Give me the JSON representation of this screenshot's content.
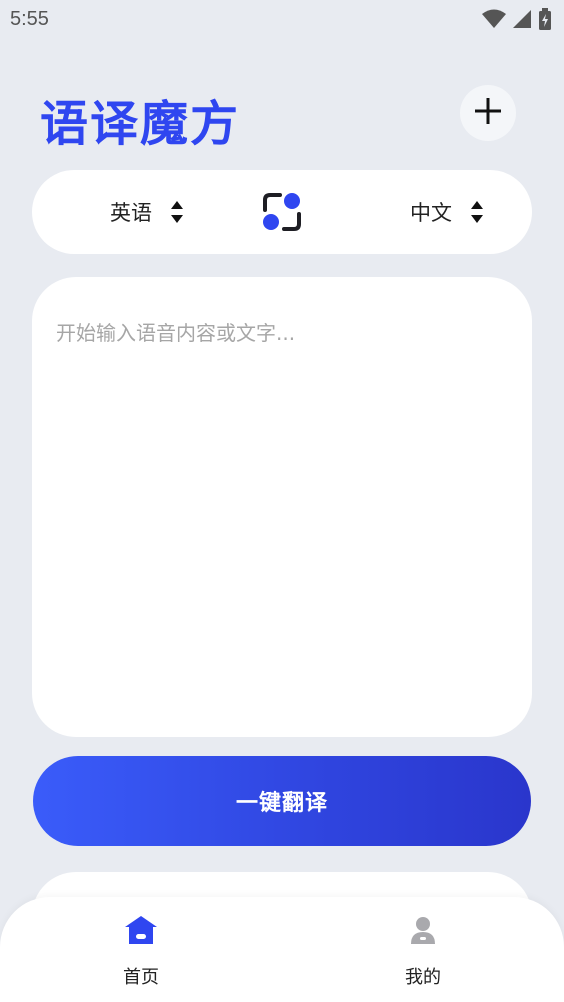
{
  "status_bar": {
    "time": "5:55",
    "icons": [
      "wifi-icon",
      "cell-signal-icon",
      "battery-charging-icon"
    ]
  },
  "header": {
    "title": "语译魔方",
    "add_icon": "plus-icon"
  },
  "language_bar": {
    "source_language": "英语",
    "target_language": "中文",
    "swap_icon": "swap-languages-icon"
  },
  "input": {
    "value": "",
    "placeholder": "开始输入语音内容或文字..."
  },
  "actions": {
    "translate_label": "一键翻译"
  },
  "bottom_nav": {
    "items": [
      {
        "label": "首页",
        "icon": "home-icon",
        "active": true
      },
      {
        "label": "我的",
        "icon": "user-icon",
        "active": false
      }
    ]
  },
  "colors": {
    "accent": "#2f46f0",
    "background": "#e8ebf1",
    "card": "#ffffff",
    "button_gradient_start": "#3a5cfa",
    "button_gradient_end": "#2a36cc",
    "inactive_icon": "#a9a9ad"
  }
}
